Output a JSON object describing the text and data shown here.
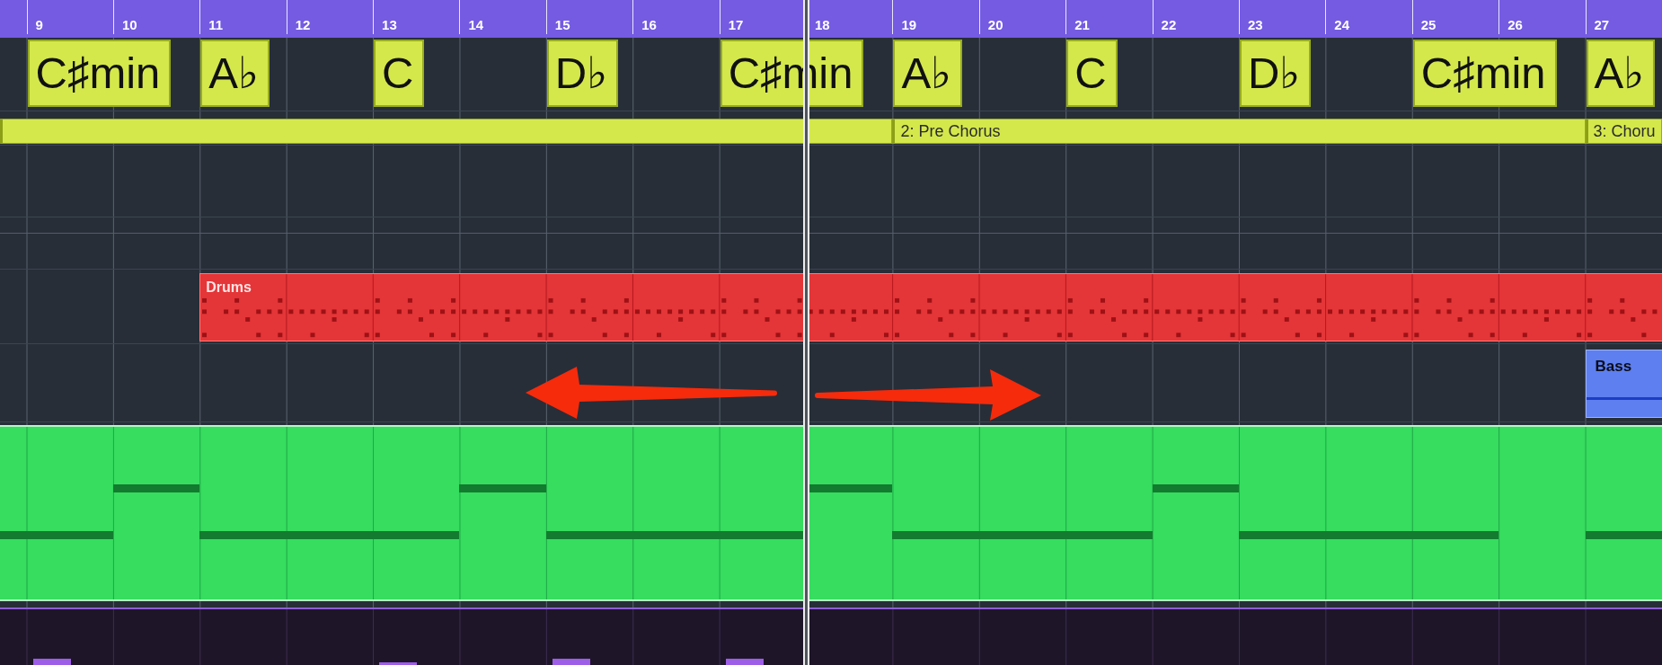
{
  "ruler": {
    "bars": [
      "9",
      "10",
      "11",
      "12",
      "13",
      "14",
      "15",
      "16",
      "17",
      "18",
      "19",
      "20",
      "21",
      "22",
      "23",
      "24",
      "25",
      "26",
      "27"
    ]
  },
  "chord_track": {
    "chords": [
      "C♯min",
      "A♭",
      "C",
      "D♭",
      "C♯min",
      "A♭",
      "C",
      "D♭",
      "C♯min",
      "A♭"
    ]
  },
  "arranger_track": {
    "sections": [
      {
        "label": "2: Pre Chorus"
      },
      {
        "label": "3: Choru"
      }
    ]
  },
  "drums_track": {
    "region": {
      "label": "Drums"
    }
  },
  "bass_track": {
    "region": {
      "label": "Bass"
    }
  }
}
